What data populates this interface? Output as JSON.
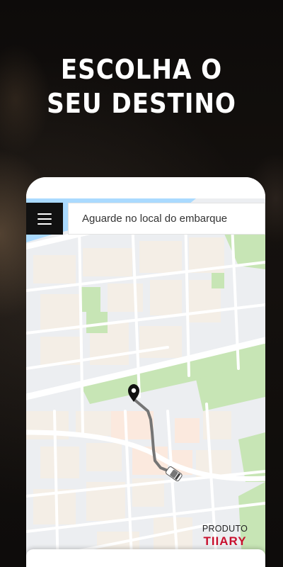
{
  "headline": {
    "line1": "ESCOLHA O",
    "line2": "SEU DESTINO"
  },
  "map_toolbar": {
    "menu_icon": "hamburger-menu-icon",
    "status_text": "Aguarde no local do embarque"
  },
  "map": {
    "destination_icon": "location-pin-icon",
    "vehicle_icon": "car-icon",
    "route_color": "#757575",
    "colors": {
      "water": "#aadaff",
      "park": "#c7e5b5",
      "block": "#f4eee6",
      "block_alt": "#fbe9de",
      "road": "#ffffff",
      "base": "#eceef1"
    }
  },
  "brand": {
    "top": "PRODUTO",
    "main": "TIIARY",
    "color": "#c8102e"
  }
}
